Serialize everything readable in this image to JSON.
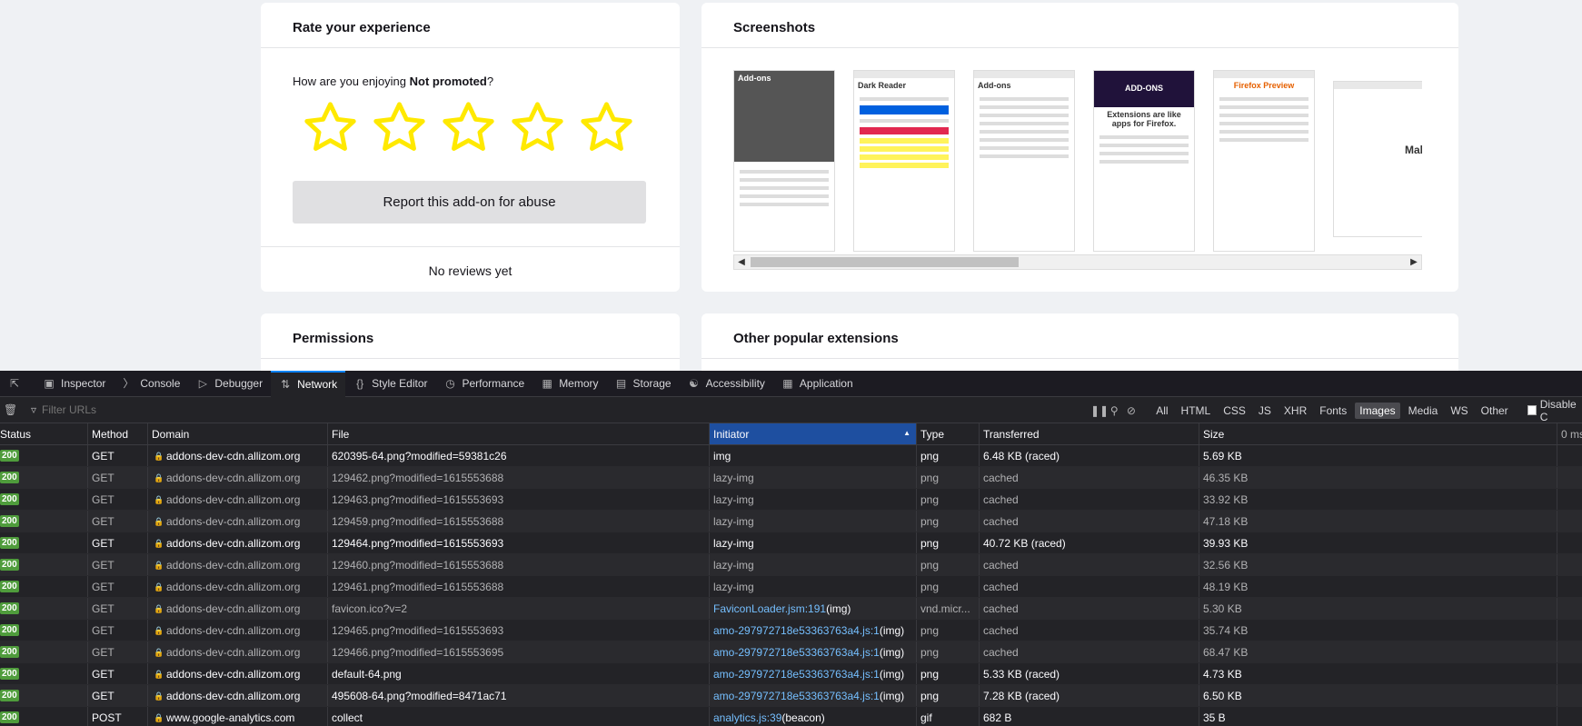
{
  "rate_card": {
    "title": "Rate your experience",
    "question_prefix": "How are you enjoying ",
    "addon_name": "Not promoted",
    "question_suffix": "?",
    "stars": [
      1,
      2,
      3,
      4,
      5
    ],
    "star_color": "#ffe900",
    "abuse_button": "Report this add-on for abuse",
    "no_reviews": "No reviews yet"
  },
  "screenshots_card": {
    "title": "Screenshots",
    "thumbs": [
      {
        "title": "Add-ons"
      },
      {
        "title": "Dark Reader"
      },
      {
        "title": "Add-ons"
      },
      {
        "title": "Extensions are like apps for Firefox."
      },
      {
        "title": "Firefox Preview"
      },
      {
        "title": "Make"
      }
    ]
  },
  "permissions_card": {
    "title": "Permissions"
  },
  "other_card": {
    "title": "Other popular extensions"
  },
  "devtools": {
    "tabs": [
      {
        "icon": "pick-icon",
        "label": ""
      },
      {
        "icon": "inspector-icon",
        "label": "Inspector"
      },
      {
        "icon": "console-icon",
        "label": "Console"
      },
      {
        "icon": "debugger-icon",
        "label": "Debugger"
      },
      {
        "icon": "network-icon",
        "label": "Network"
      },
      {
        "icon": "style-editor-icon",
        "label": "Style Editor"
      },
      {
        "icon": "performance-icon",
        "label": "Performance"
      },
      {
        "icon": "memory-icon",
        "label": "Memory"
      },
      {
        "icon": "storage-icon",
        "label": "Storage"
      },
      {
        "icon": "accessibility-icon",
        "label": "Accessibility"
      },
      {
        "icon": "application-icon",
        "label": "Application"
      }
    ],
    "selected_tab": "Network",
    "filter_placeholder": "Filter URLs",
    "type_filters": [
      "All",
      "HTML",
      "CSS",
      "JS",
      "XHR",
      "Fonts",
      "Images",
      "Media",
      "WS",
      "Other"
    ],
    "selected_filter": "Images",
    "disable_cache_label": "Disable C",
    "columns": [
      "Status",
      "Method",
      "Domain",
      "File",
      "Initiator",
      "Type",
      "Transferred",
      "Size"
    ],
    "waterfall_label": "0 ms",
    "rows": [
      {
        "status": "200",
        "method": "GET",
        "domain": "addons-dev-cdn.allizom.org",
        "file": "620395-64.png?modified=59381c26",
        "initiator": "img",
        "initiator_link": "",
        "type": "png",
        "transferred": "6.48 KB (raced)",
        "size": "5.69 KB",
        "bright": true
      },
      {
        "status": "200",
        "method": "GET",
        "domain": "addons-dev-cdn.allizom.org",
        "file": "129462.png?modified=1615553688",
        "initiator": "lazy-img",
        "initiator_link": "",
        "type": "png",
        "transferred": "cached",
        "size": "46.35 KB",
        "bright": false
      },
      {
        "status": "200",
        "method": "GET",
        "domain": "addons-dev-cdn.allizom.org",
        "file": "129463.png?modified=1615553693",
        "initiator": "lazy-img",
        "initiator_link": "",
        "type": "png",
        "transferred": "cached",
        "size": "33.92 KB",
        "bright": false
      },
      {
        "status": "200",
        "method": "GET",
        "domain": "addons-dev-cdn.allizom.org",
        "file": "129459.png?modified=1615553688",
        "initiator": "lazy-img",
        "initiator_link": "",
        "type": "png",
        "transferred": "cached",
        "size": "47.18 KB",
        "bright": false
      },
      {
        "status": "200",
        "method": "GET",
        "domain": "addons-dev-cdn.allizom.org",
        "file": "129464.png?modified=1615553693",
        "initiator": "lazy-img",
        "initiator_link": "",
        "type": "png",
        "transferred": "40.72 KB (raced)",
        "size": "39.93 KB",
        "bright": true
      },
      {
        "status": "200",
        "method": "GET",
        "domain": "addons-dev-cdn.allizom.org",
        "file": "129460.png?modified=1615553688",
        "initiator": "lazy-img",
        "initiator_link": "",
        "type": "png",
        "transferred": "cached",
        "size": "32.56 KB",
        "bright": false
      },
      {
        "status": "200",
        "method": "GET",
        "domain": "addons-dev-cdn.allizom.org",
        "file": "129461.png?modified=1615553688",
        "initiator": "lazy-img",
        "initiator_link": "",
        "type": "png",
        "transferred": "cached",
        "size": "48.19 KB",
        "bright": false
      },
      {
        "status": "200",
        "method": "GET",
        "domain": "addons-dev-cdn.allizom.org",
        "file": "favicon.ico?v=2",
        "initiator": "",
        "initiator_link": "FaviconLoader.jsm:191",
        "initiator_suffix": " (img)",
        "type": "vnd.micr...",
        "transferred": "cached",
        "size": "5.30 KB",
        "bright": false
      },
      {
        "status": "200",
        "method": "GET",
        "domain": "addons-dev-cdn.allizom.org",
        "file": "129465.png?modified=1615553693",
        "initiator": "",
        "initiator_link": "amo-297972718e53363763a4.js:1",
        "initiator_suffix": " (img)",
        "type": "png",
        "transferred": "cached",
        "size": "35.74 KB",
        "bright": false
      },
      {
        "status": "200",
        "method": "GET",
        "domain": "addons-dev-cdn.allizom.org",
        "file": "129466.png?modified=1615553695",
        "initiator": "",
        "initiator_link": "amo-297972718e53363763a4.js:1",
        "initiator_suffix": " (img)",
        "type": "png",
        "transferred": "cached",
        "size": "68.47 KB",
        "bright": false
      },
      {
        "status": "200",
        "method": "GET",
        "domain": "addons-dev-cdn.allizom.org",
        "file": "default-64.png",
        "initiator": "",
        "initiator_link": "amo-297972718e53363763a4.js:1",
        "initiator_suffix": " (img)",
        "type": "png",
        "transferred": "5.33 KB (raced)",
        "size": "4.73 KB",
        "bright": true
      },
      {
        "status": "200",
        "method": "GET",
        "domain": "addons-dev-cdn.allizom.org",
        "file": "495608-64.png?modified=8471ac71",
        "initiator": "",
        "initiator_link": "amo-297972718e53363763a4.js:1",
        "initiator_suffix": " (img)",
        "type": "png",
        "transferred": "7.28 KB (raced)",
        "size": "6.50 KB",
        "bright": true
      },
      {
        "status": "200",
        "method": "POST",
        "domain": "www.google-analytics.com",
        "file": "collect",
        "initiator": "",
        "initiator_link": "analytics.js:39",
        "initiator_suffix": " (beacon)",
        "type": "gif",
        "transferred": "682 B",
        "size": "35 B",
        "bright": true
      }
    ]
  }
}
